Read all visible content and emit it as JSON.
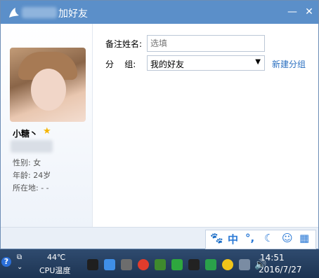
{
  "window": {
    "title": "加好友"
  },
  "profile": {
    "nickname": "小糖丶",
    "gender_label": "性别: 女",
    "age_label": "年龄: 24岁",
    "location_label": "所在地: -  -"
  },
  "form": {
    "remark_label": "备注姓名:",
    "remark_placeholder": "选填",
    "group_label": "分    组:",
    "group_value": "我的好友",
    "new_group_link": "新建分组"
  },
  "ime": {
    "chinese_label": "中",
    "punct_label": "°,"
  },
  "taskbar": {
    "temperature": "44℃",
    "cpu_label": "CPU温度",
    "time": "14:51",
    "date": "2016/7/27"
  },
  "colors": {
    "titlebar": "#5b8fc9",
    "link": "#2a6fc0",
    "ime_blue": "#2a79d6"
  }
}
